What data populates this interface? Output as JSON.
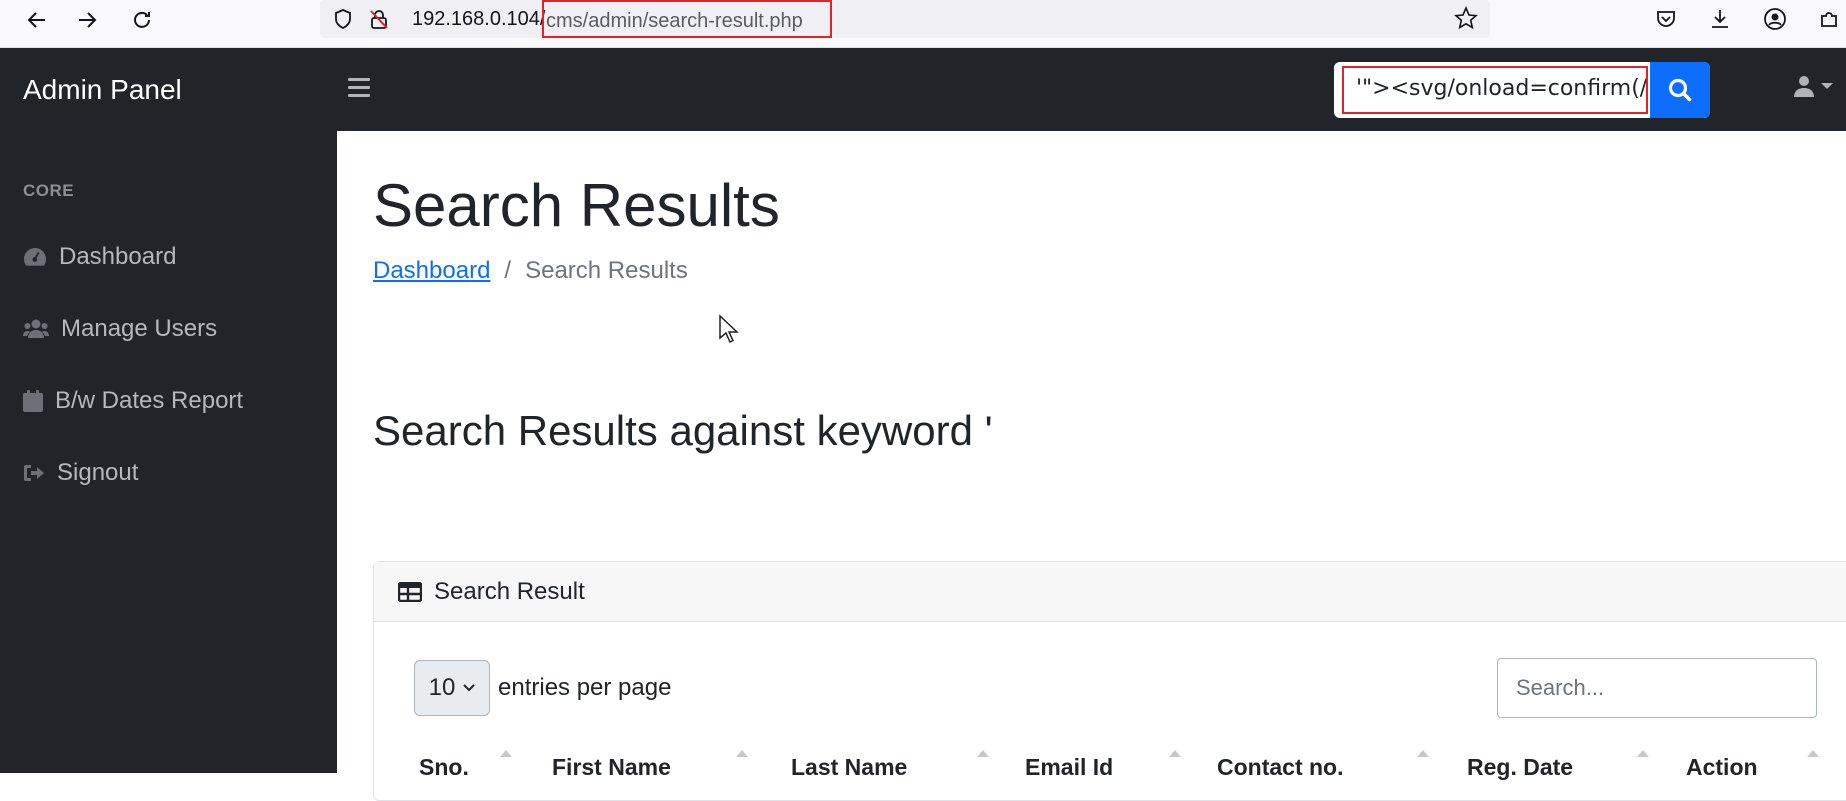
{
  "browser": {
    "url_host": "192.168.0.104/",
    "url_path": "cms/admin/search-result.php"
  },
  "navbar": {
    "brand": "Admin Panel",
    "search_value": "'\"><svg/onload=confirm(/"
  },
  "sidebar": {
    "heading": "CORE",
    "items": [
      {
        "label": "Dashboard",
        "icon": "tachometer-icon"
      },
      {
        "label": "Manage Users",
        "icon": "users-icon"
      },
      {
        "label": "B/w Dates Report",
        "icon": "calendar-icon"
      },
      {
        "label": "Signout",
        "icon": "signout-icon"
      }
    ]
  },
  "main": {
    "title": "Search Results",
    "breadcrumb": {
      "link": "Dashboard",
      "separator": "/",
      "active": "Search Results"
    },
    "keyword_heading": "Search Results against keyword '"
  },
  "card": {
    "header": "Search Result",
    "entries_value": "10",
    "entries_label": "entries per page",
    "search_placeholder": "Search...",
    "columns": [
      "Sno.",
      "First Name",
      "Last Name",
      "Email Id",
      "Contact no.",
      "Reg. Date",
      "Action"
    ]
  },
  "colors": {
    "navbar_bg": "#212529",
    "accent": "#0d6efd",
    "highlight_border": "#e0242a"
  }
}
